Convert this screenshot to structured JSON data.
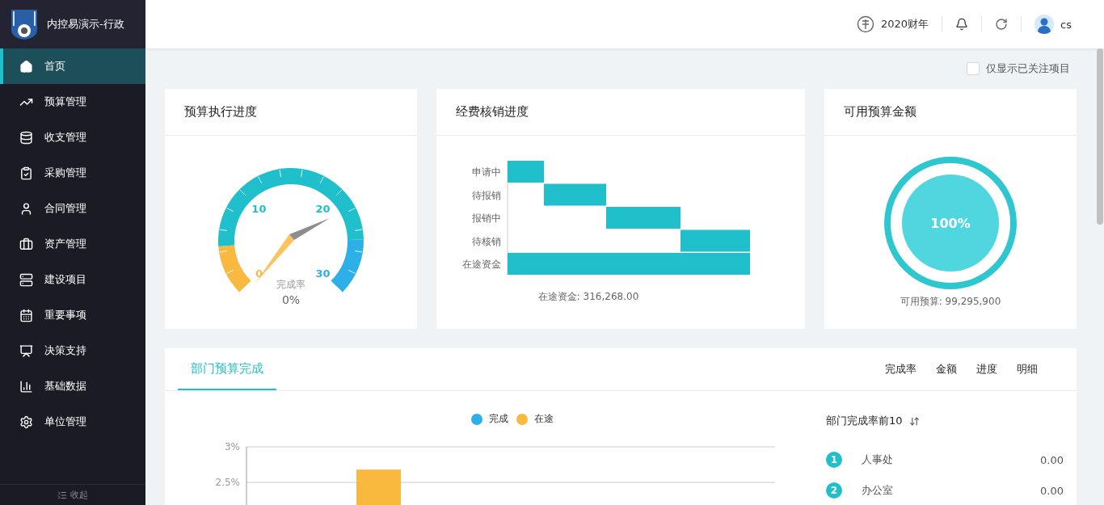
{
  "sidebar": {
    "app_title": "内控易演示-行政",
    "items": [
      {
        "label": "首页",
        "selected": true
      },
      {
        "label": "预算管理",
        "selected": false
      },
      {
        "label": "收支管理",
        "selected": false
      },
      {
        "label": "采购管理",
        "selected": false
      },
      {
        "label": "合同管理",
        "selected": false
      },
      {
        "label": "资产管理",
        "selected": false
      },
      {
        "label": "建设项目",
        "selected": false
      },
      {
        "label": "重要事项",
        "selected": false
      },
      {
        "label": "决策支持",
        "selected": false
      },
      {
        "label": "基础数据",
        "selected": false
      },
      {
        "label": "单位管理",
        "selected": false
      }
    ],
    "collapse": "收起"
  },
  "header": {
    "fiscal_year": "2020财年",
    "user": "cs"
  },
  "filter": {
    "label": "仅显示已关注项目",
    "checked": false
  },
  "budget_progress": {
    "title": "预算执行进度",
    "tick_labels": [
      "10",
      "20",
      "0",
      "30"
    ],
    "caption": "完成率",
    "value": "0%"
  },
  "expense_progress": {
    "title": "经费核销进度",
    "categories": [
      "申请中",
      "待报销",
      "报销中",
      "待核销",
      "在途资金"
    ],
    "caption": "在途资金: 316,268.00"
  },
  "available_budget": {
    "title": "可用预算金额",
    "level": 1,
    "value": "100%",
    "caption": "可用预算: 99,295,900"
  },
  "department": {
    "tabs": [
      {
        "label": "部门预算完成",
        "selected": true
      }
    ],
    "options": [
      "完成率",
      "金额",
      "进度",
      "明细"
    ],
    "chart_data": {
      "type": "bar",
      "series": [
        {
          "name": "完成",
          "color": "#2db0e8",
          "values": [
            null,
            null
          ]
        },
        {
          "name": "在途",
          "color": "#f9b93f",
          "values": [
            2.68,
            null
          ]
        }
      ],
      "ylim": [
        0,
        3
      ],
      "yticks": [
        {
          "value": 2.5,
          "label": "2.5%"
        },
        {
          "value": 3,
          "label": "3%"
        }
      ]
    },
    "ranking": {
      "title": "部门完成率前10",
      "rows": [
        {
          "rank": "1",
          "name": "人事处",
          "value": "0.00"
        },
        {
          "rank": "2",
          "name": "办公室",
          "value": "0.00"
        }
      ]
    }
  }
}
